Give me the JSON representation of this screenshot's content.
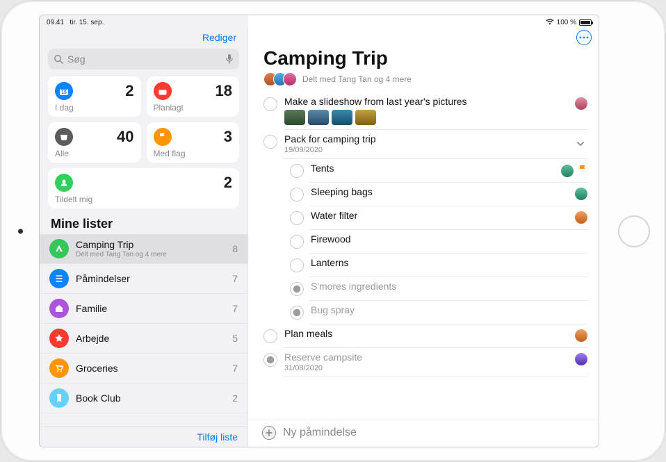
{
  "status": {
    "time": "09.41",
    "date": "tir. 15. sep.",
    "wifi": "wifi",
    "battery_pct": "100 %"
  },
  "sidebar": {
    "edit_label": "Rediger",
    "search_placeholder": "Søg",
    "cards": {
      "today": {
        "label": "I dag",
        "count": "2"
      },
      "planned": {
        "label": "Planlagt",
        "count": "18"
      },
      "all": {
        "label": "Alle",
        "count": "40"
      },
      "flagged": {
        "label": "Med flag",
        "count": "3"
      },
      "assigned": {
        "label": "Tildelt mig",
        "count": "2"
      }
    },
    "my_lists_header": "Mine lister",
    "lists": [
      {
        "name": "Camping Trip",
        "sub": "Delt med Tang Tan og 4 mere",
        "count": "8"
      },
      {
        "name": "Påmindelser",
        "count": "7"
      },
      {
        "name": "Familie",
        "count": "7"
      },
      {
        "name": "Arbejde",
        "count": "5"
      },
      {
        "name": "Groceries",
        "count": "7"
      },
      {
        "name": "Book Club",
        "count": "2"
      }
    ],
    "add_list_label": "Tilføj liste"
  },
  "main": {
    "title": "Camping Trip",
    "shared_label": "Delt med Tang Tan og 4 mere",
    "tasks": {
      "slideshow": {
        "title": "Make a slideshow from last year's pictures"
      },
      "pack": {
        "title": "Pack for camping trip",
        "date": "19/09/2020"
      },
      "tents": {
        "title": "Tents"
      },
      "sleeping": {
        "title": "Sleeping bags"
      },
      "water": {
        "title": "Water filter"
      },
      "firewood": {
        "title": "Firewood"
      },
      "lanterns": {
        "title": "Lanterns"
      },
      "smores": {
        "title": "S'mores ingredients"
      },
      "bugspray": {
        "title": "Bug spray"
      },
      "meals": {
        "title": "Plan meals"
      },
      "campsite": {
        "title": "Reserve campsite",
        "date": "31/08/2020"
      }
    },
    "new_reminder_label": "Ny påmindelse"
  }
}
